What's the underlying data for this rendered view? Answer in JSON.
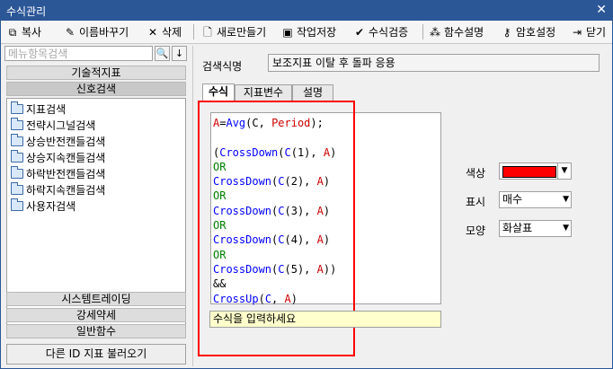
{
  "window": {
    "title": "수식관리",
    "close": "✕"
  },
  "toolbar": {
    "copy": "복사",
    "rename": "이름바꾸기",
    "delete": "삭제",
    "new": "새로만들기",
    "save": "작업저장",
    "verify": "수식검증",
    "func_desc": "함수설명",
    "password": "암호설정",
    "close": "닫기"
  },
  "sidebar": {
    "search_placeholder": "메뉴항목검색",
    "search_icon": "search-icon",
    "down_icon": "arrow-down-icon",
    "categories": {
      "technical": "기술적지표",
      "signal": "신호검색",
      "trading": "시스템트레이딩",
      "strength": "강세약세",
      "general": "일반함수"
    },
    "tree": [
      "지표검색",
      "전략시그널검색",
      "상승반전캔들검색",
      "상승지속캔들검색",
      "하락반전캔들검색",
      "하락지속캔들검색",
      "사용자검색"
    ],
    "load_button": "다른 ID 지표 불러오기"
  },
  "main": {
    "name_label": "검색식명",
    "name_value": "보조지표 이탈 후 돌파 응용",
    "tabs": [
      "수식",
      "지표변수",
      "설명"
    ],
    "active_tab": "수식",
    "hint": "수식을 입력하세요",
    "props": {
      "color_label": "색상",
      "color_value": "#ff0000",
      "display_label": "표시",
      "display_value": "매수",
      "shape_label": "모양",
      "shape_value": "화살표"
    }
  },
  "code_colors": {
    "red": "#cc0000",
    "blue": "#0000ff",
    "green": "#008000"
  },
  "code_lines": [
    "A=Avg(C, Period);",
    "",
    "(CrossDown(C(1), A)",
    "OR",
    "CrossDown(C(2), A)",
    "OR",
    "CrossDown(C(3), A)",
    "OR",
    "CrossDown(C(4), A)",
    "OR",
    "CrossDown(C(5), A))",
    "&&",
    "CrossUp(C, A)"
  ]
}
